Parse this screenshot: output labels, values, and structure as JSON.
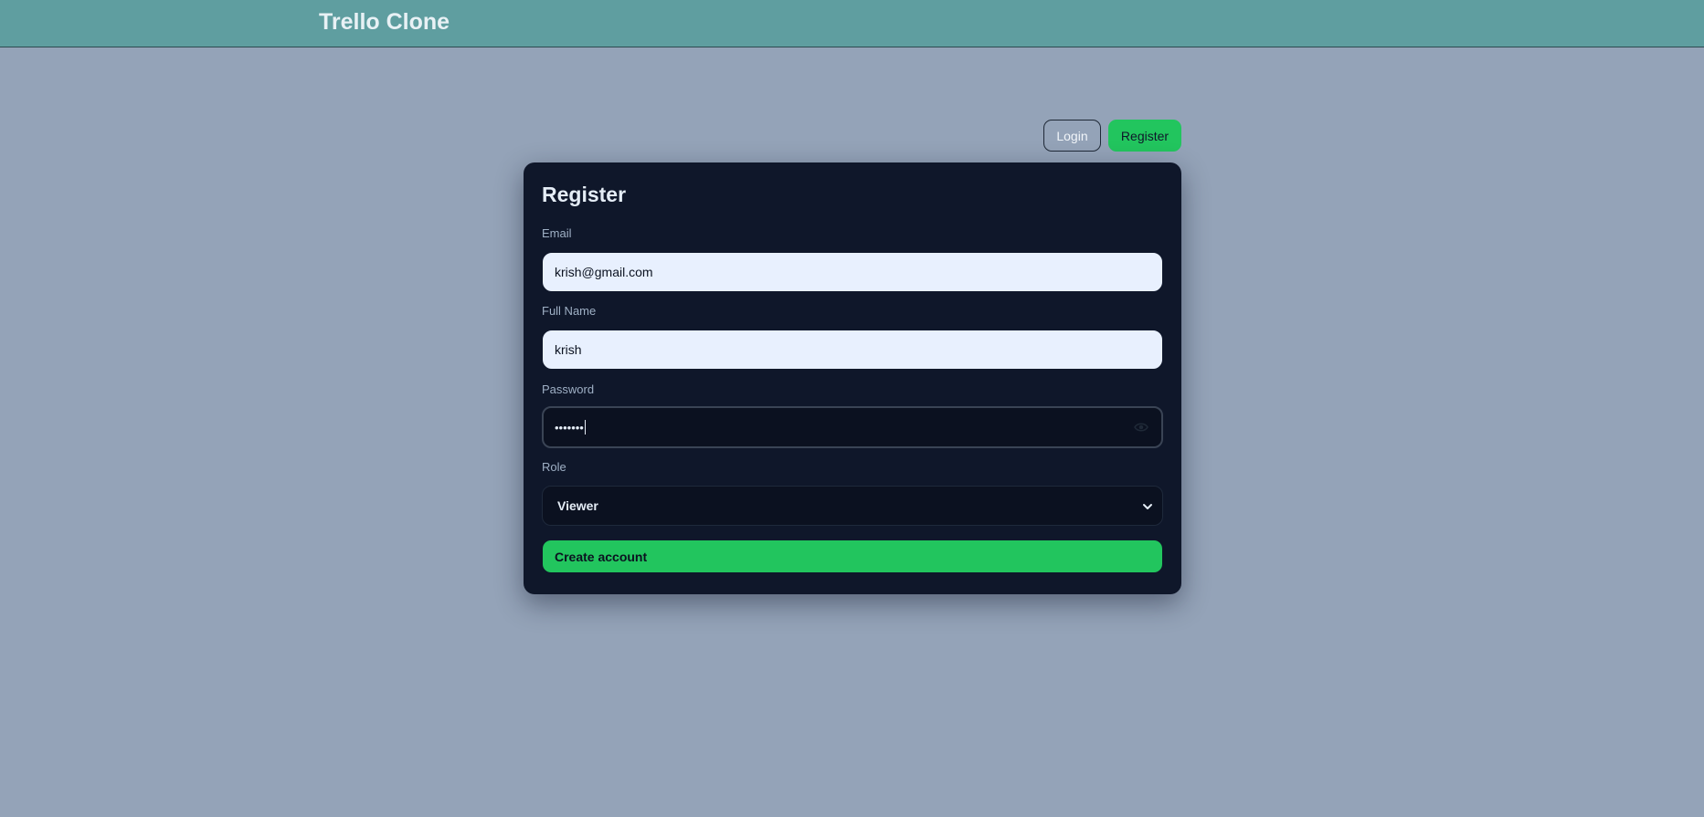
{
  "header": {
    "app_title": "Trello Clone"
  },
  "nav": {
    "login_label": "Login",
    "register_label": "Register"
  },
  "form": {
    "title": "Register",
    "email": {
      "label": "Email",
      "value": "krish@gmail.com"
    },
    "full_name": {
      "label": "Full Name",
      "value": "krish"
    },
    "password": {
      "label": "Password",
      "masked_value": "•••••••"
    },
    "role": {
      "label": "Role",
      "selected": "Viewer"
    },
    "submit_label": "Create account"
  },
  "icons": {
    "password_toggle": "eye-icon",
    "select_arrow": "chevron-down-icon"
  },
  "colors": {
    "header_bg": "#5f9ea0",
    "page_bg": "#94a3b8",
    "card_bg": "#0f172a",
    "accent_green": "#22c55e",
    "input_light_bg": "#e8f0fe"
  }
}
